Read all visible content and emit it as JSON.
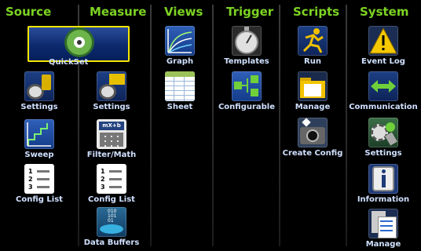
{
  "headers": {
    "source": "Source",
    "measure": "Measure",
    "views": "Views",
    "trigger": "Trigger",
    "scripts": "Scripts",
    "system": "System"
  },
  "source": {
    "quickset": "QuickSet",
    "settings": "Settings",
    "sweep": "Sweep",
    "config_list": "Config List"
  },
  "measure": {
    "settings": "Settings",
    "filter_math": "Filter/Math",
    "config_list": "Config List",
    "data_buffers": "Data Buffers"
  },
  "views": {
    "graph": "Graph",
    "sheet": "Sheet"
  },
  "trigger": {
    "templates": "Templates",
    "configurable": "Configurable"
  },
  "scripts": {
    "run": "Run",
    "manage": "Manage",
    "create_config": "Create Config"
  },
  "system": {
    "event_log": "Event Log",
    "communication": "Communication",
    "settings": "Settings",
    "information": "Information",
    "manage": "Manage"
  },
  "icon_glyphs": {
    "filter_math_text": "mX+b",
    "list_numbers": [
      "1",
      "2",
      "3"
    ]
  },
  "colors": {
    "header_green": "#7cd322",
    "selection_yellow": "#f5e600",
    "label": "#cfe0ff",
    "background": "#000000"
  }
}
